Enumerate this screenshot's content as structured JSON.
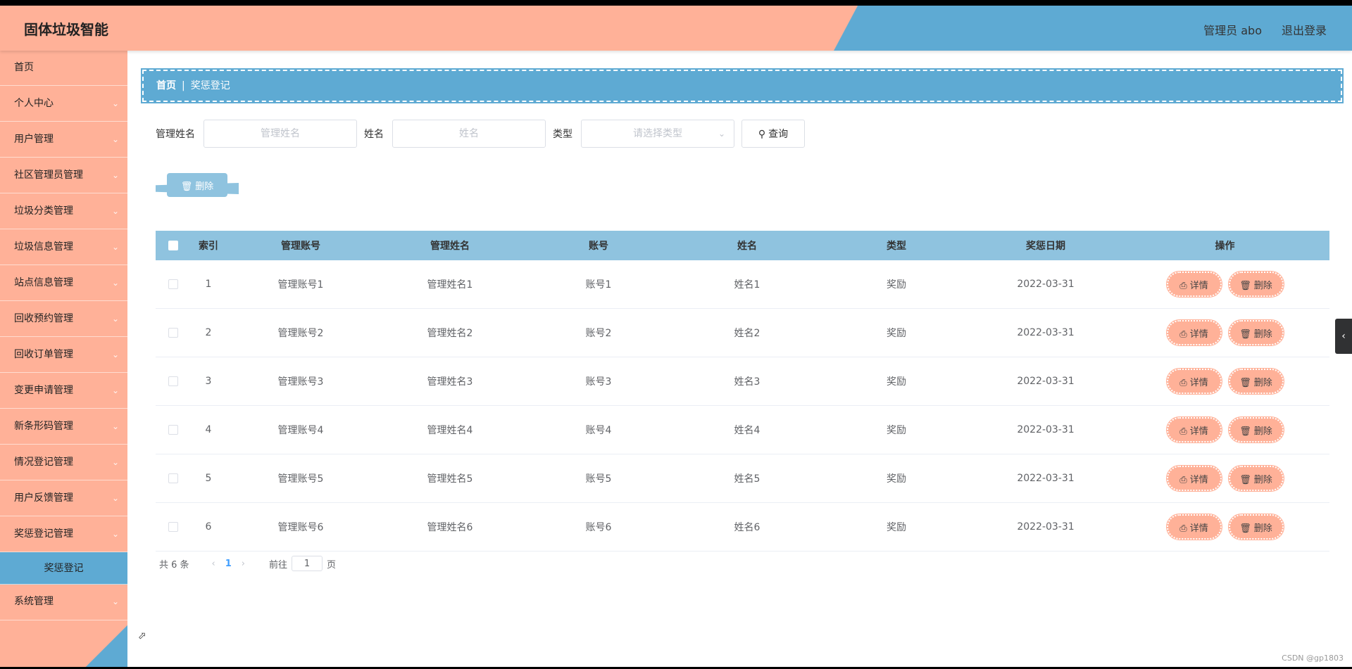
{
  "header": {
    "brand": "固体垃圾智能",
    "user": "管理员 abo",
    "logout": "退出登录"
  },
  "sidebar": {
    "home": "首页",
    "items": [
      {
        "label": "个人中心"
      },
      {
        "label": "用户管理"
      },
      {
        "label": "社区管理员管理"
      },
      {
        "label": "垃圾分类管理"
      },
      {
        "label": "垃圾信息管理"
      },
      {
        "label": "站点信息管理"
      },
      {
        "label": "回收预约管理"
      },
      {
        "label": "回收订单管理"
      },
      {
        "label": "变更申请管理"
      },
      {
        "label": "新条形码管理"
      },
      {
        "label": "情况登记管理"
      },
      {
        "label": "用户反馈管理"
      },
      {
        "label": "奖惩登记管理"
      }
    ],
    "submenu": "奖惩登记",
    "system": "系统管理"
  },
  "breadcrumb": {
    "home": "首页",
    "sep": "|",
    "current": "奖惩登记"
  },
  "search": {
    "admin_name_label": "管理姓名",
    "admin_name_placeholder": "管理姓名",
    "name_label": "姓名",
    "name_placeholder": "姓名",
    "type_label": "类型",
    "type_placeholder": "请选择类型",
    "query_button": "查询"
  },
  "actions": {
    "delete_button": "删除"
  },
  "table": {
    "headers": [
      "索引",
      "管理账号",
      "管理姓名",
      "账号",
      "姓名",
      "类型",
      "奖惩日期",
      "操作"
    ],
    "rows": [
      {
        "idx": "1",
        "acc": "管理账号1",
        "name": "管理姓名1",
        "user": "账号1",
        "uname": "姓名1",
        "type": "奖励",
        "date": "2022-03-31"
      },
      {
        "idx": "2",
        "acc": "管理账号2",
        "name": "管理姓名2",
        "user": "账号2",
        "uname": "姓名2",
        "type": "奖励",
        "date": "2022-03-31"
      },
      {
        "idx": "3",
        "acc": "管理账号3",
        "name": "管理姓名3",
        "user": "账号3",
        "uname": "姓名3",
        "type": "奖励",
        "date": "2022-03-31"
      },
      {
        "idx": "4",
        "acc": "管理账号4",
        "name": "管理姓名4",
        "user": "账号4",
        "uname": "姓名4",
        "type": "奖励",
        "date": "2022-03-31"
      },
      {
        "idx": "5",
        "acc": "管理账号5",
        "name": "管理姓名5",
        "user": "账号5",
        "uname": "姓名5",
        "type": "奖励",
        "date": "2022-03-31"
      },
      {
        "idx": "6",
        "acc": "管理账号6",
        "name": "管理姓名6",
        "user": "账号6",
        "uname": "姓名6",
        "type": "奖励",
        "date": "2022-03-31"
      }
    ],
    "detail_label": "详情",
    "delete_label": "删除"
  },
  "pager": {
    "total": "共 6 条",
    "current": "1",
    "goto": "前往",
    "page_value": "1",
    "page_unit": "页"
  },
  "watermark": "CSDN @gp1803",
  "colors": {
    "salmon": "#ffb198",
    "blue": "#5eaad3",
    "light_blue": "#8fc3df"
  },
  "icons": {
    "chevron": "chevron-down-icon",
    "search": "search-icon",
    "delete": "trash-icon",
    "detail": "document-icon"
  }
}
